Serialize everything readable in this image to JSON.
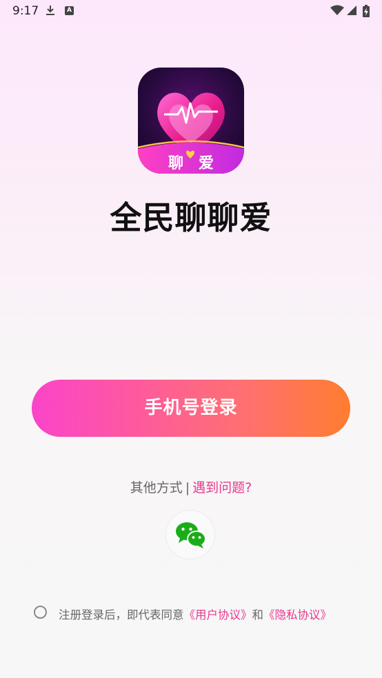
{
  "status_bar": {
    "time": "9:17"
  },
  "app": {
    "name": "全民聊聊爱",
    "logo_text_left": "聊",
    "logo_text_right": "爱"
  },
  "login": {
    "phone_button": "手机号登录"
  },
  "other": {
    "label": "其他方式",
    "separator": "|",
    "problem_link": "遇到问题?"
  },
  "agreement": {
    "prefix": "注册登录后，即代表同意",
    "user_agreement": "《用户协议》",
    "and": "和",
    "privacy_policy": "《隐私协议》"
  },
  "colors": {
    "accent_pink": "#e8388e",
    "button_start": "#fb44c9",
    "button_end": "#ff7d2f"
  }
}
